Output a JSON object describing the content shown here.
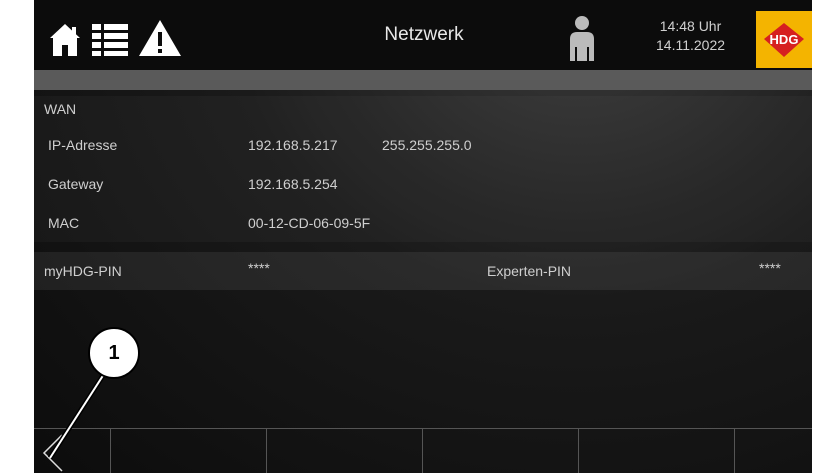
{
  "header": {
    "title": "Netzwerk",
    "time": "14:48 Uhr",
    "date": "14.11.2022",
    "logo_text": "HDG",
    "icons": [
      "home-icon",
      "list-icon",
      "warning-icon",
      "user-icon"
    ]
  },
  "wan": {
    "heading": "WAN",
    "rows": [
      {
        "label": "IP-Adresse",
        "value": "192.168.5.217",
        "value2": "255.255.255.0"
      },
      {
        "label": "Gateway",
        "value": "192.168.5.254"
      },
      {
        "label": "MAC",
        "value": "00-12-CD-06-09-5F"
      }
    ]
  },
  "pins": {
    "myhdg_label": "myHDG-PIN",
    "myhdg_value": "****",
    "expert_label": "Experten-PIN",
    "expert_value": "****"
  },
  "callout": {
    "number": "1"
  },
  "colors": {
    "accent": "#f4b400",
    "background": "#1a1a1a",
    "text": "#cfcfcf"
  }
}
